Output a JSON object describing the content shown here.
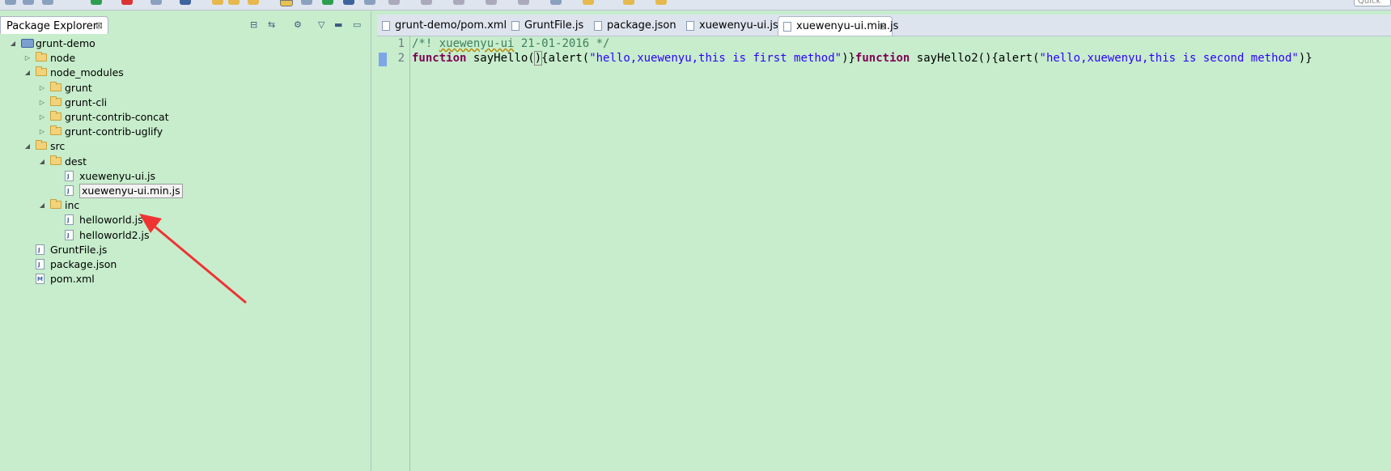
{
  "quick_access": {
    "label": "Quick"
  },
  "package_explorer": {
    "title": "Package Explorer",
    "close_glyph": "⊠",
    "tree": [
      {
        "label": "grunt-demo",
        "type": "project",
        "depth": 0,
        "expanded": true
      },
      {
        "label": "node",
        "type": "folder",
        "depth": 1,
        "expanded": false
      },
      {
        "label": "node_modules",
        "type": "folder",
        "depth": 1,
        "expanded": true
      },
      {
        "label": "grunt",
        "type": "folder",
        "depth": 2,
        "expanded": false
      },
      {
        "label": "grunt-cli",
        "type": "folder",
        "depth": 2,
        "expanded": false
      },
      {
        "label": "grunt-contrib-concat",
        "type": "folder",
        "depth": 2,
        "expanded": false
      },
      {
        "label": "grunt-contrib-uglify",
        "type": "folder",
        "depth": 2,
        "expanded": false
      },
      {
        "label": "src",
        "type": "folder",
        "depth": 1,
        "expanded": true
      },
      {
        "label": "dest",
        "type": "folder",
        "depth": 2,
        "expanded": true
      },
      {
        "label": "xuewenyu-ui.js",
        "type": "js",
        "depth": 3
      },
      {
        "label": "xuewenyu-ui.min.js",
        "type": "js",
        "depth": 3,
        "selected": true
      },
      {
        "label": "inc",
        "type": "folder",
        "depth": 2,
        "expanded": true
      },
      {
        "label": "helloworld.js",
        "type": "js",
        "depth": 3
      },
      {
        "label": "helloworld2.js",
        "type": "js",
        "depth": 3
      },
      {
        "label": "GruntFile.js",
        "type": "js",
        "depth": 1
      },
      {
        "label": "package.json",
        "type": "json",
        "depth": 1
      },
      {
        "label": "pom.xml",
        "type": "xml",
        "depth": 1
      }
    ]
  },
  "editor": {
    "tabs": [
      {
        "label": "grunt-demo/pom.xml",
        "icon": "maven-file-icon"
      },
      {
        "label": "GruntFile.js",
        "icon": "js-file-icon"
      },
      {
        "label": "package.json",
        "icon": "json-file-icon"
      },
      {
        "label": "xuewenyu-ui.js",
        "icon": "js-file-icon"
      },
      {
        "label": "xuewenyu-ui.min.js",
        "icon": "js-file-icon",
        "active": true
      }
    ],
    "lines": [
      {
        "num": "1",
        "comment_prefix": "/*! ",
        "comment_word": "xuewenyu-ui",
        "comment_rest": " 21-01-2016 */"
      },
      {
        "num": "2",
        "kw1": "function",
        "t1": " sayHello(",
        "cursor_char": ")",
        "t2": "{alert(",
        "s1": "\"hello,xuewenyu,this is first method\"",
        "t3": ")}",
        "kw2": "function",
        "t4": " sayHello2(){alert(",
        "s2": "\"hello,xuewenyu,this is second method\"",
        "t5": ")}"
      }
    ]
  },
  "colors": {
    "background": "#c7edcc",
    "annotation_arrow": "#ee3333"
  }
}
